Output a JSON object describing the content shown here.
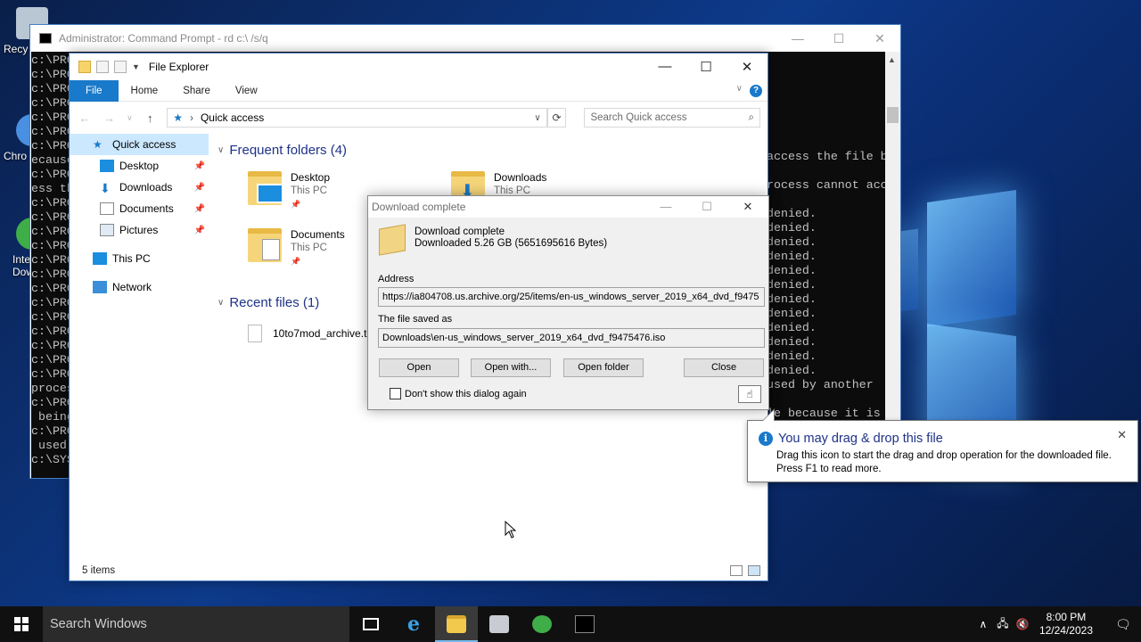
{
  "desktop": {
    "icons": [
      {
        "label": "Recy"
      },
      {
        "label": "Chro"
      },
      {
        "label": "Inte Dow"
      }
    ]
  },
  "cmd": {
    "title": "Administrator: Command Prompt - rd  c:\\ /s/q",
    "left_lines": [
      "c:\\PRO",
      "c:\\PRO",
      "c:\\PRO",
      "c:\\PRO",
      "c:\\PRO",
      "c:\\PRO",
      "c:\\PRO",
      "ecause",
      "c:\\PRO",
      "ess th",
      "c:\\PRO",
      "c:\\PRO",
      "c:\\PRO",
      "c:\\PRO",
      "c:\\PRO",
      "c:\\PRO",
      "c:\\PRO",
      "c:\\PRO",
      "c:\\PRO",
      "c:\\PRO",
      "c:\\PRO",
      "c:\\PRO",
      "c:\\PRO",
      "proces",
      "c:\\PRO",
      " being",
      "c:\\PRO",
      " used ",
      "c:\\SYS"
    ],
    "right_lines": [
      "",
      "",
      "",
      "",
      "",
      "access the file b",
      "",
      "rocess cannot acc",
      "",
      "denied.",
      "denied.",
      "denied.",
      "denied.",
      "denied.",
      "denied.",
      "denied.",
      "denied.",
      "denied.",
      "denied.",
      "denied.",
      "denied.",
      "used by another",
      "",
      "le because it is"
    ]
  },
  "explorer": {
    "title": "File Explorer",
    "ribbon_tabs": [
      "File",
      "Home",
      "Share",
      "View"
    ],
    "address": "Quick access",
    "search_placeholder": "Search Quick access",
    "nav": [
      {
        "label": "Quick access",
        "pinned": false
      },
      {
        "label": "Desktop",
        "pinned": true
      },
      {
        "label": "Downloads",
        "pinned": true
      },
      {
        "label": "Documents",
        "pinned": true
      },
      {
        "label": "Pictures",
        "pinned": true
      },
      {
        "label": "This PC",
        "pinned": false
      },
      {
        "label": "Network",
        "pinned": false
      }
    ],
    "frequent_header": "Frequent folders (4)",
    "frequent": [
      {
        "name": "Desktop",
        "sub": "This PC"
      },
      {
        "name": "Downloads",
        "sub": "This PC"
      },
      {
        "name": "Documents",
        "sub": "This PC"
      }
    ],
    "recent_header": "Recent files (1)",
    "recent": [
      "10to7mod_archive.to"
    ],
    "status": "5 items"
  },
  "dialog": {
    "title": "Download complete",
    "heading": "Download complete",
    "detail": "Downloaded  5.26  GB (5651695616 Bytes)",
    "address_label": "Address",
    "address_value": "https://ia804708.us.archive.org/25/items/en-us_windows_server_2019_x64_dvd_f9475",
    "saved_label": "The file saved as",
    "saved_value": "Downloads\\en-us_windows_server_2019_x64_dvd_f9475476.iso",
    "buttons": {
      "open": "Open",
      "open_with": "Open with...",
      "open_folder": "Open folder",
      "close": "Close"
    },
    "checkbox": "Don't show this dialog again"
  },
  "tooltip": {
    "title": "You may drag & drop this file",
    "line1": "Drag this icon to start the drag and drop operation for the downloaded file.",
    "line2": "Press F1 to read more."
  },
  "taskbar": {
    "search": "Search Windows",
    "time": "8:00 PM",
    "date": "12/24/2023"
  }
}
